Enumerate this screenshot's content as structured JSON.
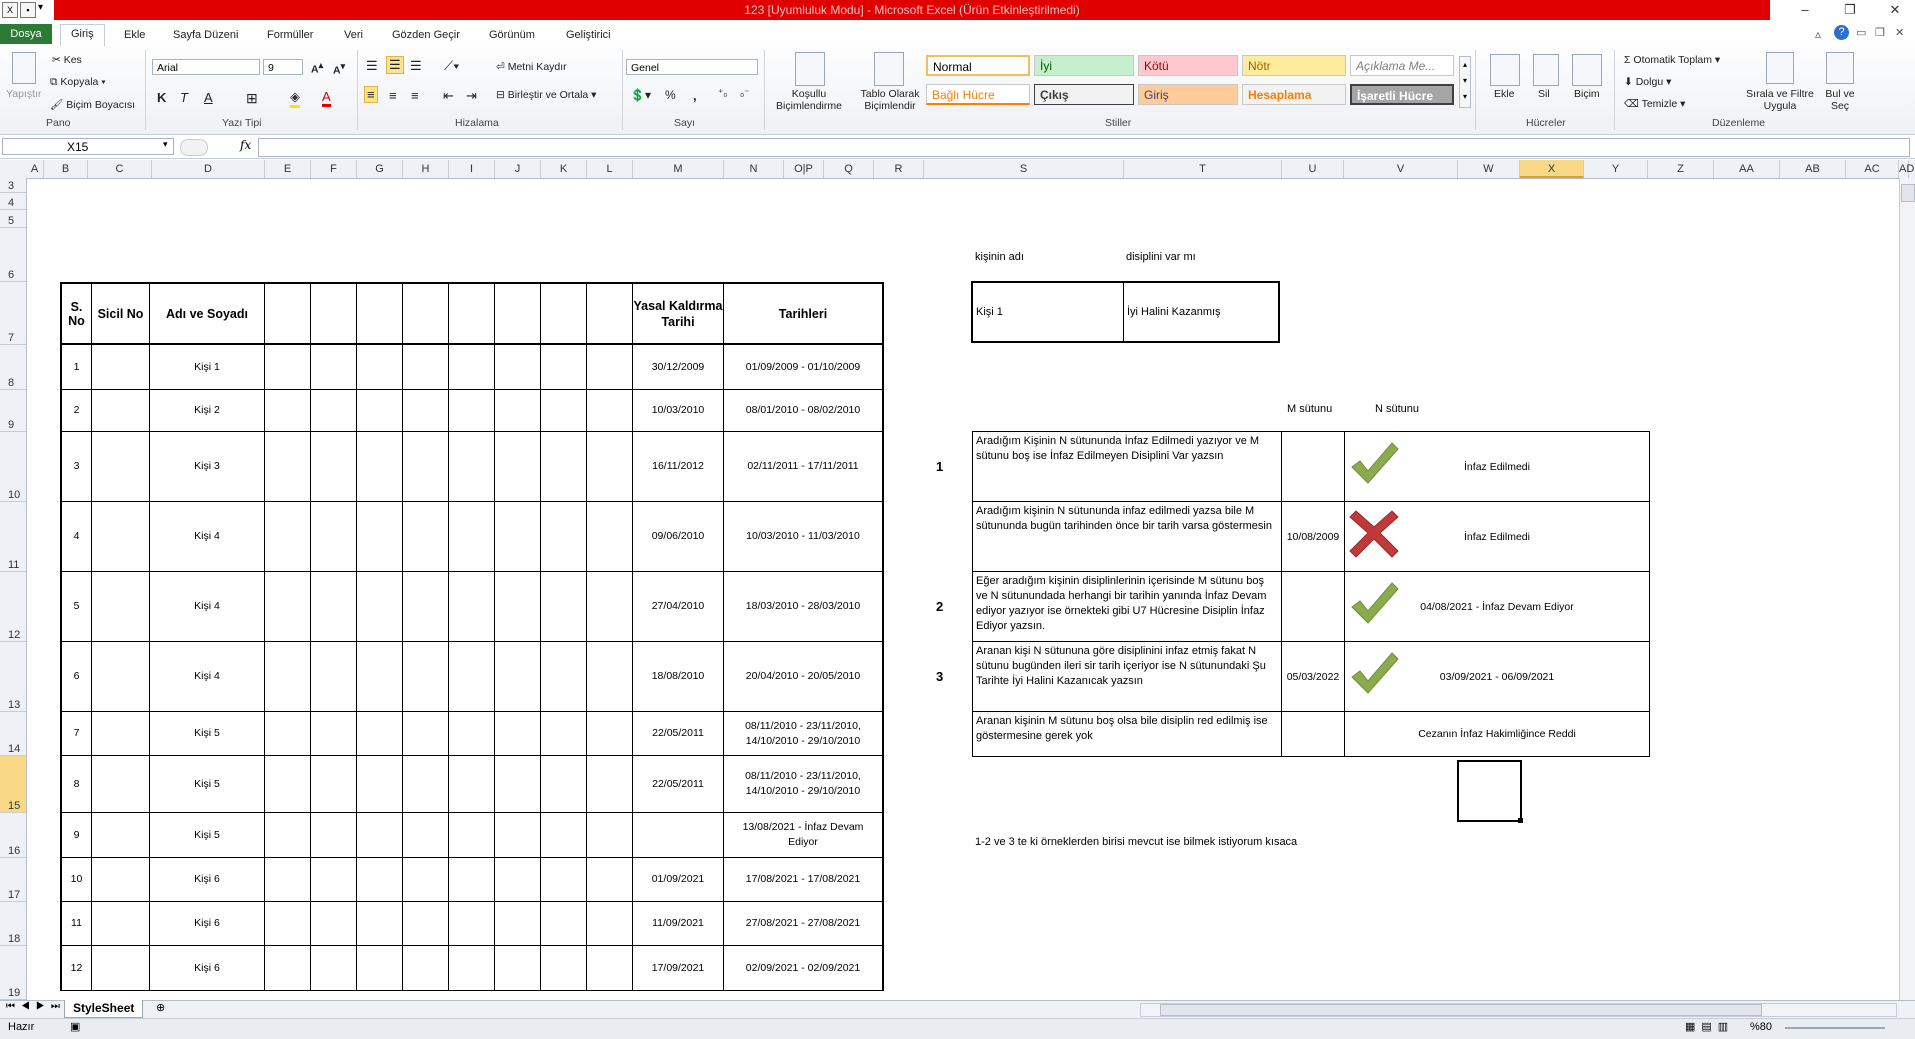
{
  "window": {
    "title": "123  [Uyumluluk Modu]  -  Microsoft Excel (Ürün Etkinleştirilmedi)"
  },
  "tabs": [
    "Dosya",
    "Giriş",
    "Ekle",
    "Sayfa Düzeni",
    "Formüller",
    "Veri",
    "Gözden Geçir",
    "Görünüm",
    "Geliştirici"
  ],
  "ribbon": {
    "clipboard": {
      "paste": "Yapıştır",
      "cut": "Kes",
      "copy": "Kopyala",
      "format_painter": "Biçim Boyacısı",
      "label": "Pano"
    },
    "font": {
      "name": "Arial",
      "size": "9",
      "bold": "K",
      "italic": "T",
      "underline": "A",
      "label": "Yazı Tipi"
    },
    "alignment": {
      "wrap": "Metni Kaydır",
      "merge": "Birleştir ve Ortala",
      "label": "Hizalama"
    },
    "number": {
      "format": "Genel",
      "percent": "%",
      "comma": ",",
      "label": "Sayı"
    },
    "styles": {
      "conditional": "Koşullu Biçimlendirme",
      "table": "Tablo Olarak Biçimlendir",
      "cells": [
        "Normal",
        "İyi",
        "Kötü",
        "Nötr",
        "Açıklama Me...",
        "Bağlı Hücre",
        "Çıkış",
        "Giriş",
        "Hesaplama",
        "İşaretli Hücre"
      ],
      "label": "Stiller"
    },
    "cells": {
      "insert": "Ekle",
      "delete": "Sil",
      "format": "Biçim",
      "label": "Hücreler"
    },
    "editing": {
      "autosum": "Otomatik Toplam",
      "fill": "Dolgu",
      "clear": "Temizle",
      "sort": "Sırala ve Filtre Uygula",
      "find": "Bul ve Seç",
      "label": "Düzenleme"
    }
  },
  "formula_bar": {
    "name_box": "X15",
    "fx": "fx",
    "value": ""
  },
  "columns": [
    "A",
    "B",
    "C",
    "D",
    "E",
    "F",
    "G",
    "H",
    "I",
    "J",
    "K",
    "L",
    "M",
    "N",
    "O",
    "P",
    "Q",
    "R",
    "S",
    "T",
    "U",
    "V",
    "W",
    "X",
    "Y",
    "Z",
    "AA",
    "AB",
    "AC",
    "AD"
  ],
  "rows": [
    "3",
    "4",
    "5",
    "6",
    "7",
    "8",
    "9",
    "10",
    "11",
    "12",
    "13",
    "14",
    "15",
    "16",
    "17",
    "18",
    "19"
  ],
  "table": {
    "headers": {
      "no": "S. No",
      "sicil": "Sicil No",
      "name": "Adı ve Soyadı",
      "yasal": "Yasal Kaldırma Tarihi",
      "tarih": "Tarihleri"
    },
    "rows": [
      {
        "no": "1",
        "name": "Kişi 1",
        "yasal": "30/12/2009",
        "tarih": "01/09/2009 - 01/10/2009"
      },
      {
        "no": "2",
        "name": "Kişi 2",
        "yasal": "10/03/2010",
        "tarih": "08/01/2010 - 08/02/2010"
      },
      {
        "no": "3",
        "name": "Kişi 3",
        "yasal": "16/11/2012",
        "tarih": "02/11/2011 - 17/11/2011"
      },
      {
        "no": "4",
        "name": "Kişi 4",
        "yasal": "09/06/2010",
        "tarih": "10/03/2010 - 11/03/2010"
      },
      {
        "no": "5",
        "name": "Kişi 4",
        "yasal": "27/04/2010",
        "tarih": "18/03/2010 - 28/03/2010"
      },
      {
        "no": "6",
        "name": "Kişi 4",
        "yasal": "18/08/2010",
        "tarih": "20/04/2010 - 20/05/2010"
      },
      {
        "no": "7",
        "name": "Kişi 5",
        "yasal": "22/05/2011",
        "tarih": "08/11/2010 - 23/11/2010,\n14/10/2010 - 29/10/2010"
      },
      {
        "no": "8",
        "name": "Kişi 5",
        "yasal": "22/05/2011",
        "tarih": "08/11/2010 - 23/11/2010,\n14/10/2010 - 29/10/2010"
      },
      {
        "no": "9",
        "name": "Kişi 5",
        "yasal": "",
        "tarih": "13/08/2021 - İnfaz Devam\nEdiyor"
      },
      {
        "no": "10",
        "name": "Kişi 6",
        "yasal": "01/09/2021",
        "tarih": "17/08/2021 - 17/08/2021"
      },
      {
        "no": "11",
        "name": "Kişi 6",
        "yasal": "11/09/2021",
        "tarih": "27/08/2021 - 27/08/2021"
      },
      {
        "no": "12",
        "name": "Kişi 6",
        "yasal": "17/09/2021",
        "tarih": "02/09/2021 - 02/09/2021"
      }
    ]
  },
  "lookup": {
    "label_name": "kişinin adı",
    "label_disiplin": "disiplini var mı",
    "name": "Kişi 1",
    "result": "İyi Halini Kazanmış"
  },
  "rules": {
    "col_m": "M sütunu",
    "col_n": "N sütunu",
    "items": [
      {
        "num": "1",
        "text": "Aradığım Kişinin N sütununda İnfaz Edilmedi yazıyor ve M sütunu boş ise İnfaz Edilmeyen Disiplini Var yazsın",
        "m": "",
        "mark": "check",
        "n": "İnfaz Edilmedi"
      },
      {
        "num": "",
        "text": "Aradığım kişinin N sütununda infaz edilmedi yazsa bile M sütununda bugün tarihinden önce bir tarih varsa göstermesin",
        "m": "10/08/2009",
        "mark": "cross",
        "n": "İnfaz Edilmedi"
      },
      {
        "num": "2",
        "text": "Eğer aradığım kişinin disiplinlerinin içerisinde M sütunu boş ve N sütunundada herhangi bir tarihin yanında İnfaz Devam ediyor yazıyor ise örnekteki gibi U7 Hücresine Disiplin İnfaz Ediyor yazsın.",
        "m": "",
        "mark": "check",
        "n": "04/08/2021 - İnfaz Devam Ediyor"
      },
      {
        "num": "3",
        "text": "Aranan kişi N sütununa göre disiplinini infaz etmiş fakat N sütunu bugünden ileri sir tarih içeriyor ise N sütunundaki Şu Tarihte İyi Halini Kazanıcak yazsın",
        "m": "05/03/2022",
        "mark": "check",
        "n": "03/09/2021 - 06/09/2021"
      },
      {
        "num": "",
        "text": "Aranan kişinin M sütunu boş olsa bile disiplin red edilmiş ise göstermesine gerek yok",
        "m": "",
        "mark": "",
        "n": "Cezanın İnfaz Hakimliğince Reddi"
      }
    ],
    "note": "1-2 ve 3 te ki örneklerden birisi mevcut ise bilmek istiyorum kısaca"
  },
  "sheet": {
    "tab": "StyleSheet"
  },
  "status": {
    "ready": "Hazır",
    "zoom": "%80"
  },
  "colors": {
    "title_red": "#e00000",
    "file_green": "#2c7a36",
    "check": "#8aac4e",
    "cross": "#c0393b"
  }
}
